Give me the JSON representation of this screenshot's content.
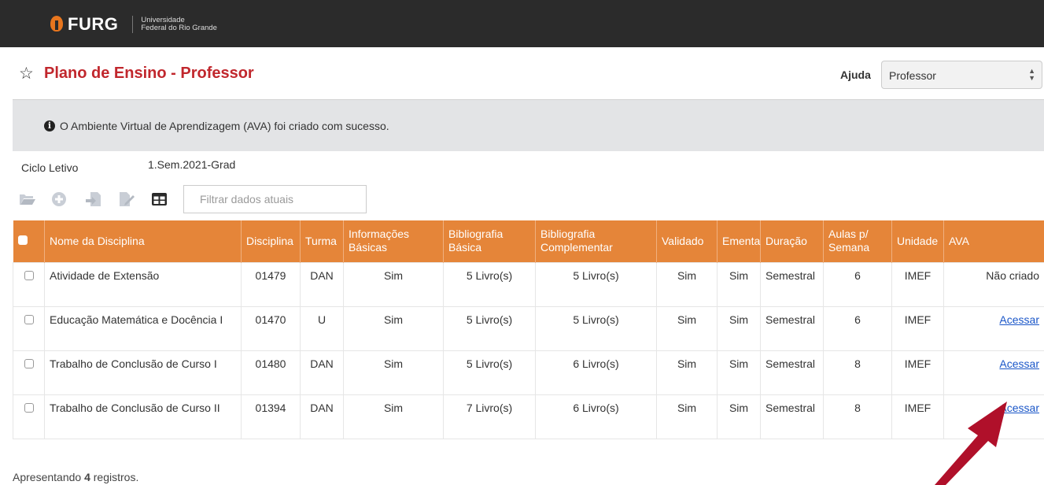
{
  "header": {
    "logo": "FURG",
    "subtitle_line1": "Universidade",
    "subtitle_line2": "Federal do Rio Grande"
  },
  "page": {
    "title": "Plano de Ensino - Professor"
  },
  "ajuda": {
    "label": "Ajuda",
    "select_value": "Professor"
  },
  "alert": {
    "message": "O Ambiente Virtual de Aprendizagem (AVA) foi criado com sucesso."
  },
  "ciclo": {
    "label": "Ciclo Letivo",
    "value": "1.Sem.2021-Grad"
  },
  "toolbar": {
    "icons": [
      "folder-open-icon",
      "plus-circle-icon",
      "import-document-icon",
      "edit-document-icon",
      "table-grid-icon"
    ],
    "filter_placeholder": "Filtrar dados atuais"
  },
  "table": {
    "headers": [
      "Nome da Disciplina",
      "Disciplina",
      "Turma",
      "Informações Básicas",
      "Bibliografia Básica",
      "Bibliografia Complementar",
      "Validado",
      "Ementa",
      "Duração",
      "Aulas p/ Semana",
      "Unidade",
      "AVA"
    ],
    "rows": [
      {
        "nome": "Atividade de Extensão",
        "disciplina": "01479",
        "turma": "DAN",
        "info": "Sim",
        "bib_basica": "5 Livro(s)",
        "bib_comp": "5 Livro(s)",
        "validado": "Sim",
        "ementa": "Sim",
        "duracao": "Semestral",
        "aulas": "6",
        "unidade": "IMEF",
        "ava": "Não criado"
      },
      {
        "nome": "Educação Matemática e Docência I",
        "disciplina": "01470",
        "turma": "U",
        "info": "Sim",
        "bib_basica": "5 Livro(s)",
        "bib_comp": "5 Livro(s)",
        "validado": "Sim",
        "ementa": "Sim",
        "duracao": "Semestral",
        "aulas": "6",
        "unidade": "IMEF",
        "ava": "Acessar"
      },
      {
        "nome": "Trabalho de Conclusão de Curso I",
        "disciplina": "01480",
        "turma": "DAN",
        "info": "Sim",
        "bib_basica": "5 Livro(s)",
        "bib_comp": "6 Livro(s)",
        "validado": "Sim",
        "ementa": "Sim",
        "duracao": "Semestral",
        "aulas": "8",
        "unidade": "IMEF",
        "ava": "Acessar"
      },
      {
        "nome": "Trabalho de Conclusão de Curso II",
        "disciplina": "01394",
        "turma": "DAN",
        "info": "Sim",
        "bib_basica": "7 Livro(s)",
        "bib_comp": "6 Livro(s)",
        "validado": "Sim",
        "ementa": "Sim",
        "duracao": "Semestral",
        "aulas": "8",
        "unidade": "IMEF",
        "ava": "Acessar"
      }
    ]
  },
  "footer": {
    "prefix": "Apresentando",
    "count": "4",
    "suffix": "registros."
  },
  "colors": {
    "topbar": "#2b2b2b",
    "title": "#c1272d",
    "table_header": "#e58539",
    "alert_bg": "#e3e4e6",
    "link": "#1a56c8",
    "annotation_arrow": "#b0102a"
  }
}
